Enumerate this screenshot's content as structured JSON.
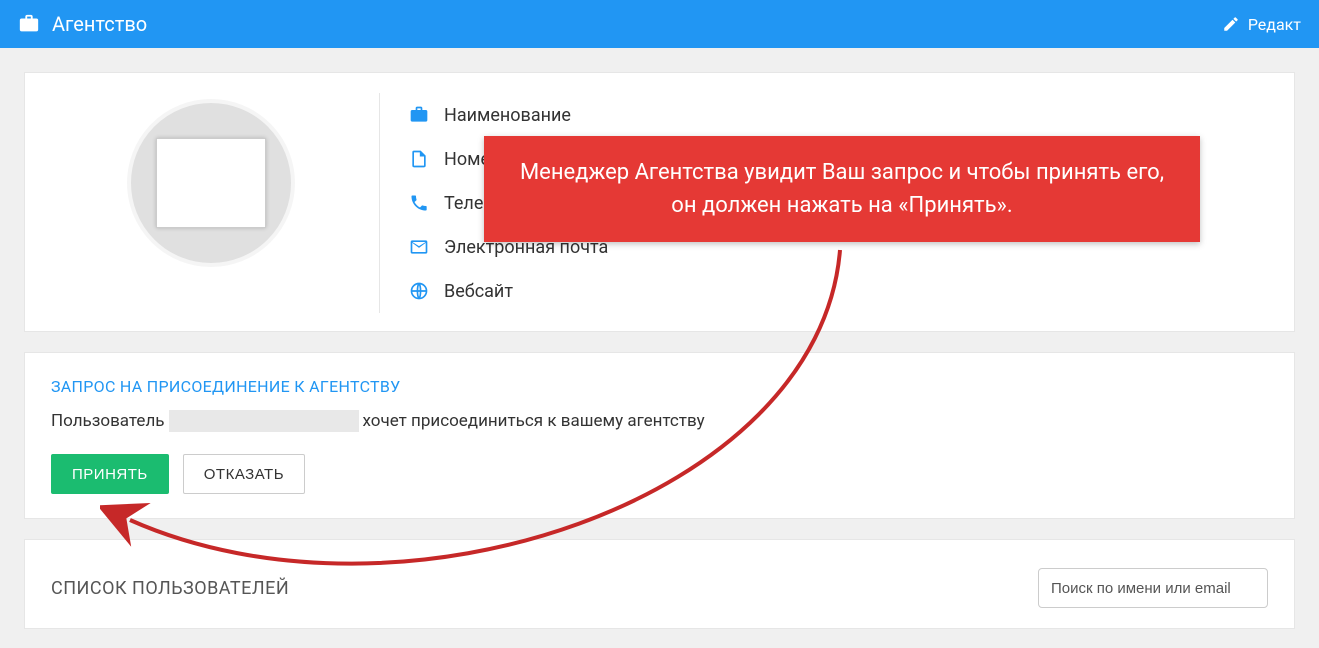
{
  "header": {
    "title": "Агентство",
    "edit": "Редакт"
  },
  "profile": {
    "name_label": "Наименование",
    "contract_label": "Номер",
    "phone_label": "Телеф",
    "email_label": "Электронная почта",
    "website_label": "Вебсайт"
  },
  "request": {
    "section_title": "ЗАПРОС НА ПРИСОЕДИНЕНИЕ К АГЕНТСТВУ",
    "text_before": "Пользователь",
    "text_after": "хочет присоединиться к вашему агентству",
    "accept_btn": "ПРИНЯТЬ",
    "decline_btn": "ОТКАЗАТЬ"
  },
  "users": {
    "section_title": "СПИСОК ПОЛЬЗОВАТЕЛЕЙ",
    "search_placeholder": "Поиск по имени или email"
  },
  "annotation": {
    "text": "Менеджер Агентства увидит Ваш запрос и чтобы принять его, он должен нажать на «Принять»."
  }
}
